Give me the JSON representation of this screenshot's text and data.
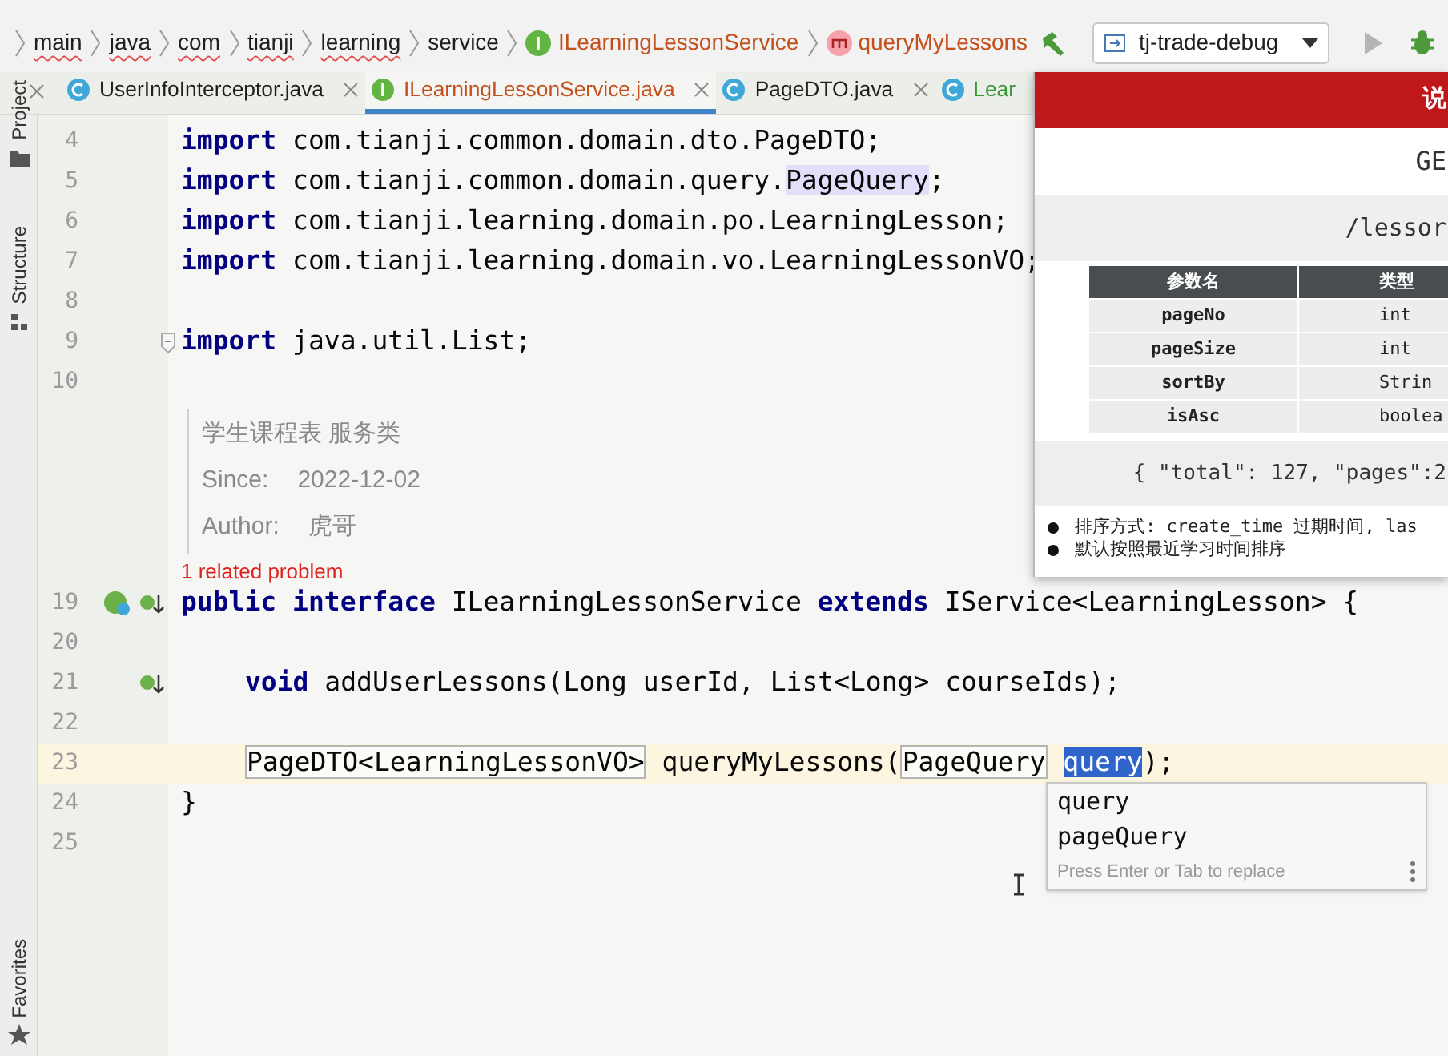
{
  "breadcrumbs": [
    {
      "label": "main",
      "kind": "package",
      "misspelled": true,
      "color": "#1f1f1f"
    },
    {
      "label": "java",
      "kind": "package",
      "misspelled": true,
      "color": "#1f1f1f"
    },
    {
      "label": "com",
      "kind": "package",
      "misspelled": true,
      "color": "#1f1f1f"
    },
    {
      "label": "tianji",
      "kind": "package",
      "misspelled": true,
      "color": "#1f1f1f"
    },
    {
      "label": "learning",
      "kind": "package",
      "misspelled": true,
      "color": "#1f1f1f"
    },
    {
      "label": "service",
      "kind": "package",
      "misspelled": false,
      "color": "#1f1f1f"
    },
    {
      "label": "ILearningLessonService",
      "kind": "interface",
      "misspelled": false,
      "color": "#c4501c"
    },
    {
      "label": "queryMyLessons",
      "kind": "method",
      "misspelled": false,
      "color": "#c4501c"
    }
  ],
  "run_config": "tj-trade-debug",
  "tool_windows": [
    {
      "label": "Project",
      "kind": "folder"
    },
    {
      "label": "Structure",
      "kind": "structure"
    },
    {
      "label": "Favorites",
      "kind": "star"
    }
  ],
  "tabs": [
    {
      "label": "UserInfoInterceptor.java",
      "kind": "class",
      "selected": false,
      "color": "#1f1f1f"
    },
    {
      "label": "ILearningLessonService.java",
      "kind": "interface",
      "selected": true,
      "color": "#c4501c"
    },
    {
      "label": "PageDTO.java",
      "kind": "class",
      "selected": false,
      "color": "#1f1f1f"
    },
    {
      "label": "Lear",
      "kind": "class",
      "selected": false,
      "color": "#3a9a3a"
    }
  ],
  "code_before": [
    {
      "number": "4",
      "current": false,
      "tokens": [
        {
          "kind": "keyword",
          "text": "import"
        },
        {
          "kind": "plain",
          "text": " com.tianji.common.domain.dto.PageDTO;"
        }
      ]
    },
    {
      "number": "5",
      "current": false,
      "tokens": [
        {
          "kind": "keyword",
          "text": "import"
        },
        {
          "kind": "plain",
          "text": " com.tianji.common.domain.query."
        },
        {
          "kind": "usage",
          "text": "PageQuery"
        },
        {
          "kind": "plain",
          "text": ";"
        }
      ]
    },
    {
      "number": "6",
      "current": false,
      "tokens": [
        {
          "kind": "keyword",
          "text": "import"
        },
        {
          "kind": "plain",
          "text": " com.tianji.learning.domain.po.LearningLesson;"
        }
      ]
    },
    {
      "number": "7",
      "current": false,
      "tokens": [
        {
          "kind": "keyword",
          "text": "import"
        },
        {
          "kind": "plain",
          "text": " com.tianji.learning.domain.vo.LearningLessonVO;"
        }
      ]
    },
    {
      "number": "8",
      "current": false
    },
    {
      "number": "9",
      "current": false,
      "markers": [
        {
          "kind": "fold"
        }
      ],
      "tokens": [
        {
          "kind": "keyword",
          "text": "import"
        },
        {
          "kind": "plain",
          "text": " java.util.List;"
        }
      ]
    },
    {
      "number": "10",
      "current": false
    }
  ],
  "doc": {
    "title": "学生课程表 服务类",
    "fields": [
      {
        "label": "Since:",
        "value": "2022-12-02"
      },
      {
        "label": "Author:",
        "value": "虎哥"
      }
    ]
  },
  "inlay_hint": "1 related problem",
  "code_after": [
    {
      "number": "19",
      "current": false,
      "markers": [
        {
          "kind": "implemented"
        },
        {
          "kind": "implements"
        }
      ],
      "tokens": [
        {
          "kind": "keyword",
          "text": "public"
        },
        {
          "kind": "keyword",
          "text": "interface",
          "space_before": true
        },
        {
          "kind": "plain",
          "text": " ILearningLessonService "
        },
        {
          "kind": "keyword",
          "text": "extends"
        },
        {
          "kind": "plain",
          "text": " IService<LearningLesson> {"
        }
      ]
    },
    {
      "number": "20",
      "current": false
    },
    {
      "number": "21",
      "current": false,
      "indent": true,
      "markers": [
        {
          "kind": "implements"
        }
      ],
      "tokens": [
        {
          "kind": "keyword",
          "text": "void"
        },
        {
          "kind": "plain",
          "text": " addUserLessons(Long userId, List<Long> courseIds);"
        }
      ]
    },
    {
      "number": "22",
      "current": false
    },
    {
      "number": "23",
      "current": true,
      "indent": true,
      "tokens": [
        {
          "kind": "boxed",
          "text": "PageDTO<LearningLessonVO>"
        },
        {
          "kind": "plain",
          "text": " queryMyLessons("
        },
        {
          "kind": "boxed",
          "text": "PageQuery"
        },
        {
          "kind": "selected",
          "text": "query",
          "space_before": true
        },
        {
          "kind": "plain",
          "text": ");"
        }
      ]
    },
    {
      "number": "24",
      "current": false,
      "tokens": [
        {
          "kind": "plain",
          "text": "}"
        }
      ]
    },
    {
      "number": "25",
      "current": false
    }
  ],
  "completion": {
    "items": [
      "query",
      "pageQuery"
    ],
    "hint": "Press Enter or Tab to replace"
  },
  "doc_panel": {
    "header": "说",
    "method": "GE",
    "path": "/lessor",
    "table": {
      "columns": [
        "参数名",
        "类型"
      ],
      "rows": [
        [
          "pageNo",
          "int"
        ],
        [
          "pageSize",
          "int"
        ],
        [
          "sortBy",
          "Strin"
        ],
        [
          "isAsc",
          "boolea"
        ]
      ]
    },
    "response": "{ \"total\": 127, \"pages\":2",
    "notes": [
      "排序方式: create_time 过期时间, las",
      "默认按照最近学习时间排序"
    ]
  }
}
